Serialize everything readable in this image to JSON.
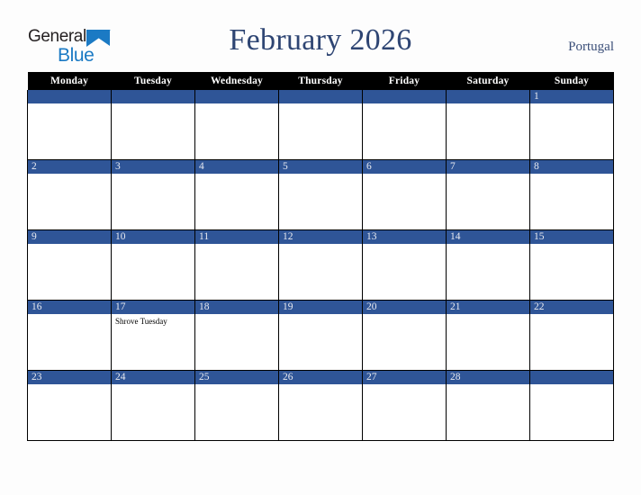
{
  "brand": {
    "name_part1": "General",
    "name_part2": "Blue",
    "triangle_icon": "blue-triangle-icon",
    "colors": {
      "dark": "#231f20",
      "blue": "#1b7ac4"
    }
  },
  "header": {
    "title": "February 2026",
    "country": "Portugal",
    "title_color": "#2e4573",
    "country_color": "#3a4e78"
  },
  "calendar": {
    "month": "February",
    "year": "2026",
    "week_start": "Monday",
    "header_bg": "#000000",
    "header_fg": "#ffffff",
    "date_bar_bg": "#2f5597",
    "date_bar_fg": "#e8eaf0",
    "cell_bg": "#ffffff",
    "grid_color": "#000000",
    "weekdays": [
      "Monday",
      "Tuesday",
      "Wednesday",
      "Thursday",
      "Friday",
      "Saturday",
      "Sunday"
    ],
    "weeks": [
      [
        {
          "date": "",
          "events": []
        },
        {
          "date": "",
          "events": []
        },
        {
          "date": "",
          "events": []
        },
        {
          "date": "",
          "events": []
        },
        {
          "date": "",
          "events": []
        },
        {
          "date": "",
          "events": []
        },
        {
          "date": "1",
          "events": []
        }
      ],
      [
        {
          "date": "2",
          "events": []
        },
        {
          "date": "3",
          "events": []
        },
        {
          "date": "4",
          "events": []
        },
        {
          "date": "5",
          "events": []
        },
        {
          "date": "6",
          "events": []
        },
        {
          "date": "7",
          "events": []
        },
        {
          "date": "8",
          "events": []
        }
      ],
      [
        {
          "date": "9",
          "events": []
        },
        {
          "date": "10",
          "events": []
        },
        {
          "date": "11",
          "events": []
        },
        {
          "date": "12",
          "events": []
        },
        {
          "date": "13",
          "events": []
        },
        {
          "date": "14",
          "events": []
        },
        {
          "date": "15",
          "events": []
        }
      ],
      [
        {
          "date": "16",
          "events": []
        },
        {
          "date": "17",
          "events": [
            "Shrove Tuesday"
          ]
        },
        {
          "date": "18",
          "events": []
        },
        {
          "date": "19",
          "events": []
        },
        {
          "date": "20",
          "events": []
        },
        {
          "date": "21",
          "events": []
        },
        {
          "date": "22",
          "events": []
        }
      ],
      [
        {
          "date": "23",
          "events": []
        },
        {
          "date": "24",
          "events": []
        },
        {
          "date": "25",
          "events": []
        },
        {
          "date": "26",
          "events": []
        },
        {
          "date": "27",
          "events": []
        },
        {
          "date": "28",
          "events": []
        },
        {
          "date": "",
          "events": []
        }
      ]
    ]
  }
}
